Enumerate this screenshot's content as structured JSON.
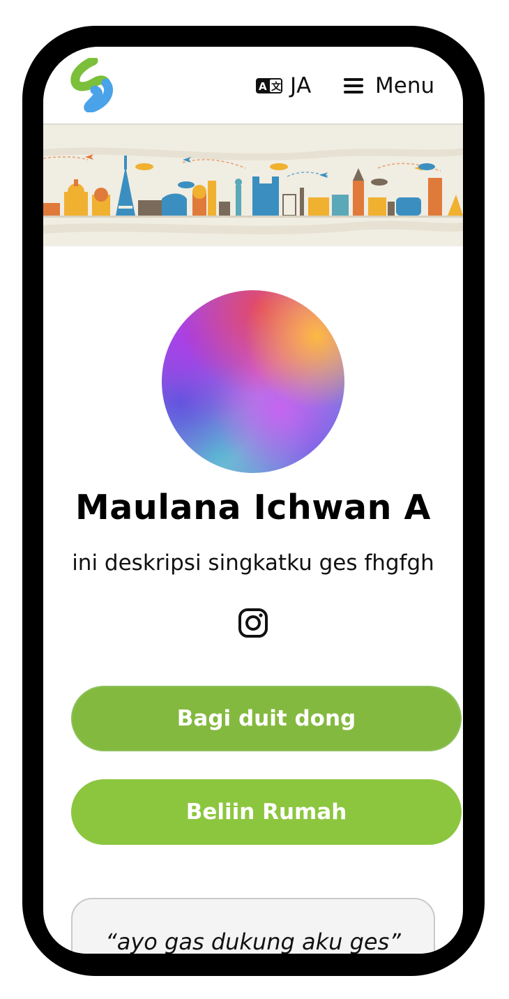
{
  "header": {
    "language_label": "JA",
    "menu_label": "Menu"
  },
  "profile": {
    "name": "Maulana Ichwan A",
    "description": "ini deskripsi singkatku ges fhgfgh"
  },
  "buttons": [
    {
      "label": "Bagi duit dong"
    },
    {
      "label": "Beliin Rumah"
    }
  ],
  "quote": {
    "text": "“ayo gas dukung aku ges”"
  },
  "colors": {
    "button_primary": "#84b93f",
    "button_secondary": "#8cc63f",
    "logo_green": "#7bbf3a",
    "logo_blue": "#4aa3e8"
  }
}
